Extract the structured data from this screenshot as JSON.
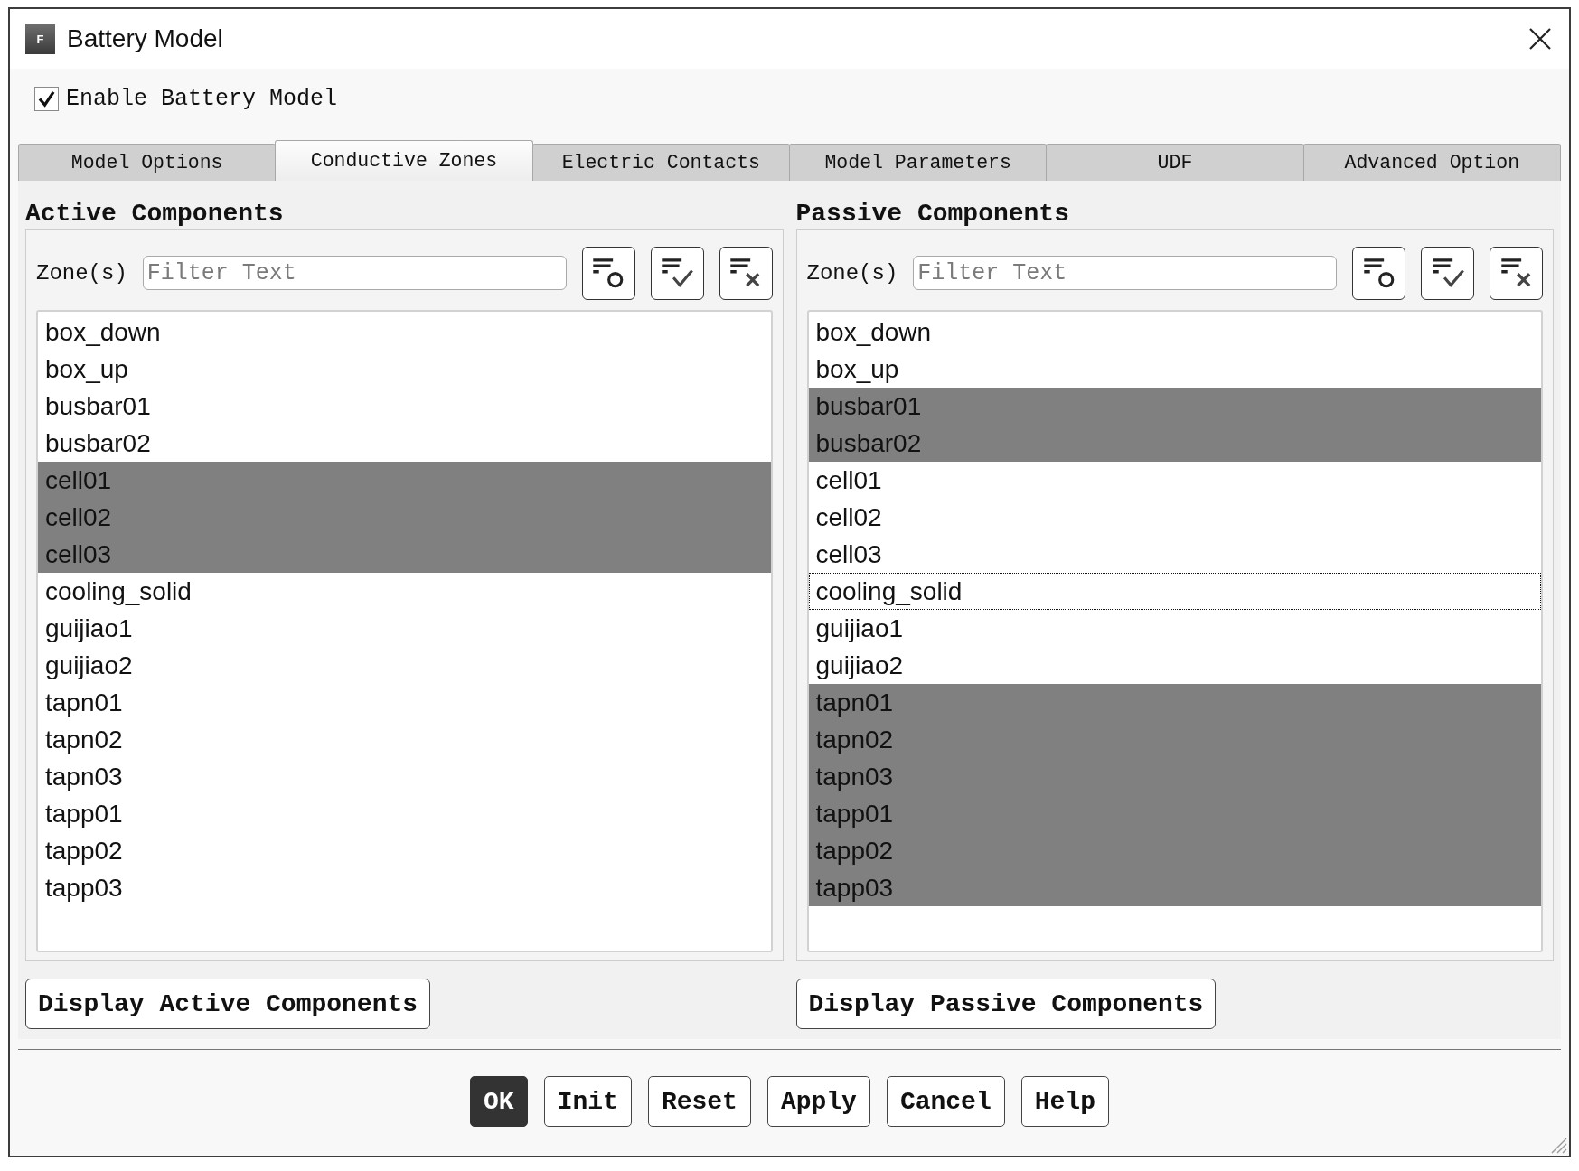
{
  "window": {
    "title": "Battery Model",
    "icon_letter": "F"
  },
  "enable_checkbox": {
    "label": "Enable Battery Model",
    "checked": true
  },
  "tabs": [
    {
      "label": "Model Options",
      "selected": false
    },
    {
      "label": "Conductive Zones",
      "selected": true
    },
    {
      "label": "Electric Contacts",
      "selected": false
    },
    {
      "label": "Model Parameters",
      "selected": false
    },
    {
      "label": "UDF",
      "selected": false
    },
    {
      "label": "Advanced Option",
      "selected": false
    }
  ],
  "panels": [
    {
      "title": "Active Components",
      "zone_label": "Zone(s)",
      "filter": {
        "placeholder": "Filter Text"
      },
      "zones": [
        {
          "name": "box_down",
          "selected": false,
          "focused": false
        },
        {
          "name": "box_up",
          "selected": false,
          "focused": false
        },
        {
          "name": "busbar01",
          "selected": false,
          "focused": false
        },
        {
          "name": "busbar02",
          "selected": false,
          "focused": false
        },
        {
          "name": "cell01",
          "selected": true,
          "focused": false
        },
        {
          "name": "cell02",
          "selected": true,
          "focused": false
        },
        {
          "name": "cell03",
          "selected": true,
          "focused": false
        },
        {
          "name": "cooling_solid",
          "selected": false,
          "focused": false
        },
        {
          "name": "guijiao1",
          "selected": false,
          "focused": false
        },
        {
          "name": "guijiao2",
          "selected": false,
          "focused": false
        },
        {
          "name": "tapn01",
          "selected": false,
          "focused": false
        },
        {
          "name": "tapn02",
          "selected": false,
          "focused": false
        },
        {
          "name": "tapn03",
          "selected": false,
          "focused": false
        },
        {
          "name": "tapp01",
          "selected": false,
          "focused": false
        },
        {
          "name": "tapp02",
          "selected": false,
          "focused": false
        },
        {
          "name": "tapp03",
          "selected": false,
          "focused": false
        }
      ],
      "display_button": "Display Active Components"
    },
    {
      "title": "Passive Components",
      "zone_label": "Zone(s)",
      "filter": {
        "placeholder": "Filter Text"
      },
      "zones": [
        {
          "name": "box_down",
          "selected": false,
          "focused": false
        },
        {
          "name": "box_up",
          "selected": false,
          "focused": false
        },
        {
          "name": "busbar01",
          "selected": true,
          "focused": false
        },
        {
          "name": "busbar02",
          "selected": true,
          "focused": false
        },
        {
          "name": "cell01",
          "selected": false,
          "focused": false
        },
        {
          "name": "cell02",
          "selected": false,
          "focused": false
        },
        {
          "name": "cell03",
          "selected": false,
          "focused": false
        },
        {
          "name": "cooling_solid",
          "selected": false,
          "focused": true
        },
        {
          "name": "guijiao1",
          "selected": false,
          "focused": false
        },
        {
          "name": "guijiao2",
          "selected": false,
          "focused": false
        },
        {
          "name": "tapn01",
          "selected": true,
          "focused": false
        },
        {
          "name": "tapn02",
          "selected": true,
          "focused": false
        },
        {
          "name": "tapn03",
          "selected": true,
          "focused": false
        },
        {
          "name": "tapp01",
          "selected": true,
          "focused": false
        },
        {
          "name": "tapp02",
          "selected": true,
          "focused": false
        },
        {
          "name": "tapp03",
          "selected": true,
          "focused": false
        }
      ],
      "display_button": "Display Passive Components"
    }
  ],
  "buttons": [
    {
      "label": "OK",
      "default": true
    },
    {
      "label": "Init",
      "default": false
    },
    {
      "label": "Reset",
      "default": false
    },
    {
      "label": "Apply",
      "default": false
    },
    {
      "label": "Cancel",
      "default": false
    },
    {
      "label": "Help",
      "default": false
    }
  ]
}
